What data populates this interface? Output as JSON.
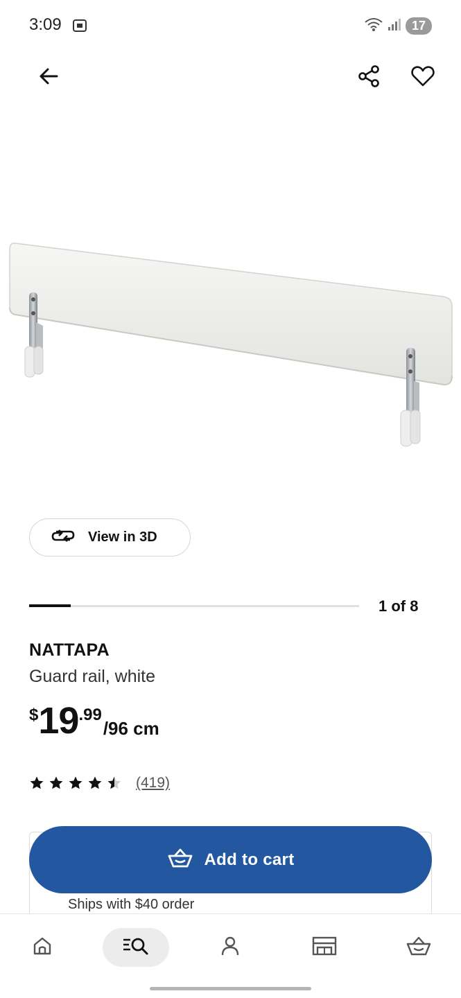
{
  "status_bar": {
    "time": "3:09",
    "battery": "17"
  },
  "top_bar": {
    "back_icon": "arrow-left-icon",
    "share_icon": "share-icon",
    "favorite_icon": "heart-icon"
  },
  "product": {
    "name": "NATTAPA",
    "description": "Guard rail, white",
    "price": {
      "currency": "$",
      "integer": "19",
      "decimal": ".99",
      "unit": "/96 cm"
    },
    "rating": {
      "stars": 4.5,
      "review_count": "(419)"
    }
  },
  "gallery": {
    "view_3d_label": "View in 3D",
    "counter": "1 of 8",
    "current": 1,
    "total": 8
  },
  "cart": {
    "add_to_cart_label": "Add to cart",
    "shipping_note": "Ships with $40 order"
  },
  "bottom_nav": {
    "items": [
      {
        "icon": "home-icon",
        "active": false
      },
      {
        "icon": "search-icon",
        "active": true
      },
      {
        "icon": "profile-icon",
        "active": false
      },
      {
        "icon": "store-icon",
        "active": false
      },
      {
        "icon": "cart-icon",
        "active": false
      }
    ]
  },
  "colors": {
    "primary_button": "#2358a0",
    "text": "#111111"
  }
}
